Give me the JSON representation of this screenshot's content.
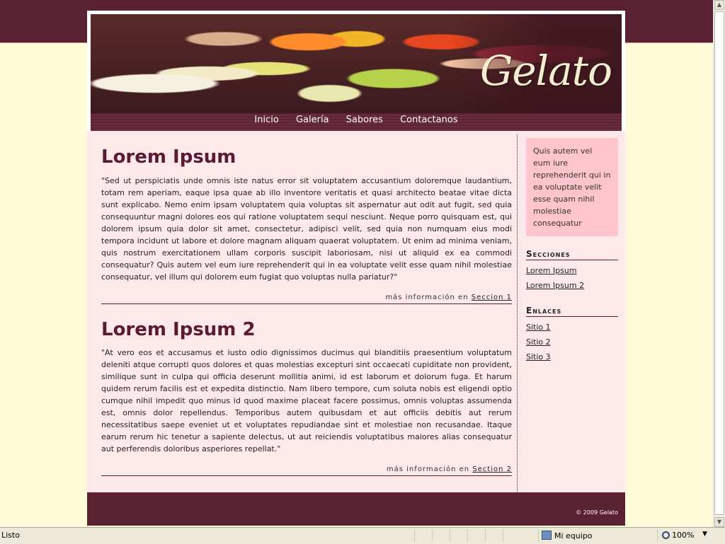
{
  "site": {
    "logo": "Gelato",
    "nav": [
      "Inicio",
      "Galería",
      "Sabores",
      "Contactanos"
    ]
  },
  "articles": [
    {
      "title": "Lorem Ipsum",
      "body": "\"Sed ut perspiciatis unde omnis iste natus error sit voluptatem accusantium doloremque laudantium, totam rem aperiam, eaque ipsa quae ab illo inventore veritatis et quasi architecto beatae vitae dicta sunt explicabo. Nemo enim ipsam voluptatem quia voluptas sit aspernatur aut odit aut fugit, sed quia consequuntur magni dolores eos qui ratione voluptatem sequi nesciunt. Neque porro quisquam est, qui dolorem ipsum quia dolor sit amet, consectetur, adipisci velit, sed quia non numquam eius modi tempora incidunt ut labore et dolore magnam aliquam quaerat voluptatem. Ut enim ad minima veniam, quis nostrum exercitationem ullam corporis suscipit laboriosam, nisi ut aliquid ex ea commodi consequatur? Quis autem vel eum iure reprehenderit qui in ea voluptate velit esse quam nihil molestiae consequatur, vel illum qui dolorem eum fugiat quo voluptas nulla pariatur?\"",
      "more_prefix": "más información en",
      "more_link": "Seccion 1"
    },
    {
      "title": "Lorem Ipsum 2",
      "body": "\"At vero eos et accusamus et iusto odio dignissimos ducimus qui blanditiis praesentium voluptatum deleniti atque corrupti quos dolores et quas molestias excepturi sint occaecati cupiditate non provident, similique sunt in culpa qui officia deserunt mollitia animi, id est laborum et dolorum fuga. Et harum quidem rerum facilis est et expedita distinctio. Nam libero tempore, cum soluta nobis est eligendi optio cumque nihil impedit quo minus id quod maxime placeat facere possimus, omnis voluptas assumenda est, omnis dolor repellendus. Temporibus autem quibusdam et aut officiis debitis aut rerum necessitatibus saepe eveniet ut et voluptates repudiandae sint et molestiae non recusandae. Itaque earum rerum hic tenetur a sapiente delectus, ut aut reiciendis voluptatibus maiores alias consequatur aut perferendis doloribus asperiores repellat.\"",
      "more_prefix": "más información en",
      "more_link": "Section 2"
    }
  ],
  "sidebar": {
    "quote": "Quis autem vel eum iure reprehenderit qui in ea voluptate velit esse quam nihil molestiae consequatur",
    "sections_title": "Secciones",
    "sections": [
      "Lorem Ipsum",
      "Lorem Ipsum 2"
    ],
    "links_title": "Enlaces",
    "links": [
      "Sitio 1",
      "Sitio 2",
      "Sitio 3"
    ]
  },
  "footer": {
    "copyright": "© 2009 Gelato"
  },
  "statusbar": {
    "status": "Listo",
    "zone": "Mi equipo",
    "zoom": "100%"
  },
  "colors": {
    "maroon": "#5a2133",
    "pink_bg": "#fde8ea",
    "quote_bg": "#ffc4cc",
    "page_bg": "#fffbd9"
  }
}
